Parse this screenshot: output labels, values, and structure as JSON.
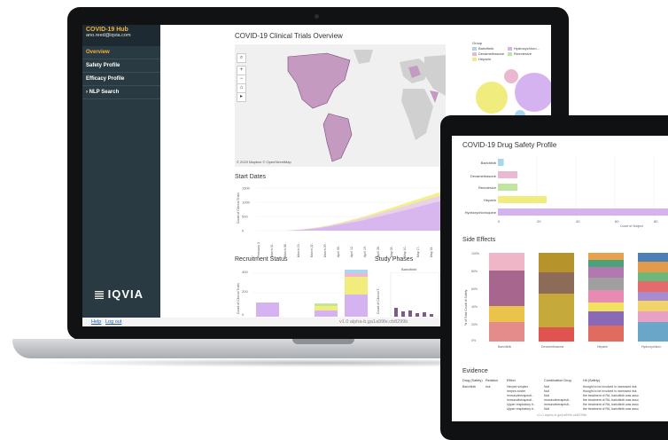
{
  "sidebar": {
    "title": "COVID-19 Hub",
    "user": "ano.reed@iqvia.com",
    "items": [
      {
        "label": "Overview"
      },
      {
        "label": "Safety Profile"
      },
      {
        "label": "Efficacy Profile"
      },
      {
        "label": "NLP Search"
      }
    ],
    "logo_text": "IQVIA"
  },
  "footer": {
    "help": "Help",
    "logout": "Log out",
    "version": "v1.0 alpha-b.ga1a99fe.cb8299b"
  },
  "overview": {
    "title": "COVID-19 Clinical Trials Overview",
    "map_credit": "© 2020 Mapbox © OpenStreetMap",
    "legend_title": "Group",
    "legend": [
      {
        "label": "Baricitinib",
        "color": "#a9d6ee"
      },
      {
        "label": "Hydroxychloro...",
        "color": "#d5b3f0"
      },
      {
        "label": "Dexamethasone",
        "color": "#eab8cf"
      },
      {
        "label": "Remdesivir",
        "color": "#bfe59e"
      },
      {
        "label": "Heparin",
        "color": "#f1ec7e"
      }
    ],
    "start_dates": {
      "title": "Start Dates",
      "ylabel": "Count of Clinical Trials",
      "yticks": [
        "1500",
        "1000",
        "500",
        "0"
      ],
      "xticks": [
        "February 2..",
        "March 01..",
        "March 08..",
        "March 15..",
        "March 22..",
        "March 29..",
        "April 05..",
        "April 12..",
        "April 19..",
        "April 26..",
        "May 03..",
        "May 10..",
        "May 17..",
        "May 24.."
      ]
    },
    "recruitment": {
      "title": "Recruitment Status",
      "ylabel": "Count of Clinical Trials",
      "yticks": [
        "400",
        "200",
        "0"
      ]
    },
    "phases": {
      "title": "Study Phases",
      "column": "Baricitinib",
      "ylabel": "Count of Clinical T..."
    }
  },
  "safety": {
    "title": "COVID-19 Drug Safety Profile",
    "bar_categories": [
      "Baricitinib",
      "Dexamethasone",
      "Remdesivir",
      "Heparin",
      "Hydroxychloroquine"
    ],
    "bar_values": [
      3,
      10,
      10,
      25,
      300
    ],
    "bar_xticks": [
      "0",
      "20",
      "40",
      "60",
      "80"
    ],
    "bar_xlabel": "Count of Subject",
    "side_effects_title": "Side Effects",
    "side_effects_ylabel": "% of Total Count of Safety",
    "side_effects_yticks": [
      "100%",
      "80%",
      "60%",
      "40%",
      "20%",
      "0%"
    ],
    "side_effects_cats": [
      "Baricitinib",
      "Dexamethasone",
      "Heparin",
      "Hydroxychloro"
    ],
    "evidence_title": "Evidence",
    "evidence_headers": [
      "Drug (Safety)",
      "Relation",
      "Effect",
      "Combination Drug",
      "Hit (Safety)"
    ],
    "evidence_rows": [
      [
        "Baricitinib",
        "risk",
        "Herpes simplex",
        "Null",
        "thought to be involved in increased risk"
      ],
      [
        "",
        "",
        "herpes zoster",
        "Null",
        "thought to be involved in increased risk"
      ],
      [
        "",
        "",
        "immunotherapeuti..",
        "Null",
        "the treatment of RA, baricitinib was asso"
      ],
      [
        "",
        "",
        "immunotherapeuti..",
        "immunotherapeuti..",
        "the treatment of RA, baricitinib was asso"
      ],
      [
        "",
        "",
        "Upper respiratory tr..",
        "immunotherapeuti..",
        "the treatment of RA, baricitinib was asso"
      ],
      [
        "",
        "",
        "Upper respiratory tr..",
        "Null",
        "the treatment of RA, baricitinib was asso"
      ]
    ],
    "version": "v1.0 alpha-b.ga1a99fe.cb8299b"
  }
}
